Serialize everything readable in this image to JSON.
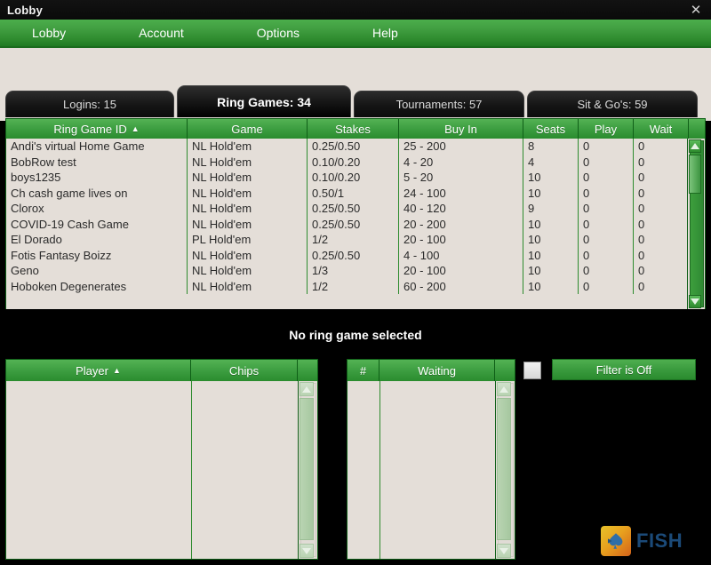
{
  "window": {
    "title": "Lobby",
    "close_label": "✕"
  },
  "menubar": {
    "items": [
      {
        "label": "Lobby"
      },
      {
        "label": "Account"
      },
      {
        "label": "Options"
      },
      {
        "label": "Help"
      }
    ]
  },
  "tabs": [
    {
      "label": "Logins: 15",
      "active": false
    },
    {
      "label": "Ring Games: 34",
      "active": true
    },
    {
      "label": "Tournaments: 57",
      "active": false
    },
    {
      "label": "Sit & Go's: 59",
      "active": false
    }
  ],
  "ring_table": {
    "columns": [
      {
        "label": "Ring Game ID",
        "sorted": true,
        "sort_indicator": "▲"
      },
      {
        "label": "Game",
        "sorted": false,
        "sort_indicator": ""
      },
      {
        "label": "Stakes",
        "sorted": false,
        "sort_indicator": ""
      },
      {
        "label": "Buy In",
        "sorted": false,
        "sort_indicator": ""
      },
      {
        "label": "Seats",
        "sorted": false,
        "sort_indicator": ""
      },
      {
        "label": "Play",
        "sorted": false,
        "sort_indicator": ""
      },
      {
        "label": "Wait",
        "sorted": false,
        "sort_indicator": ""
      }
    ],
    "rows": [
      {
        "id": "Andi's virtual Home Game",
        "game": "NL Hold'em",
        "stakes": "0.25/0.50",
        "buyin": "25 - 200",
        "seats": "8",
        "play": "0",
        "wait": "0"
      },
      {
        "id": "BobRow test",
        "game": "NL Hold'em",
        "stakes": "0.10/0.20",
        "buyin": "4 - 20",
        "seats": "4",
        "play": "0",
        "wait": "0"
      },
      {
        "id": "boys1235",
        "game": "NL Hold'em",
        "stakes": "0.10/0.20",
        "buyin": "5 - 20",
        "seats": "10",
        "play": "0",
        "wait": "0"
      },
      {
        "id": "Ch cash game lives on",
        "game": "NL Hold'em",
        "stakes": "0.50/1",
        "buyin": "24 - 100",
        "seats": "10",
        "play": "0",
        "wait": "0"
      },
      {
        "id": "Clorox",
        "game": "NL Hold'em",
        "stakes": "0.25/0.50",
        "buyin": "40 - 120",
        "seats": "9",
        "play": "0",
        "wait": "0"
      },
      {
        "id": "COVID-19 Cash Game",
        "game": "NL Hold'em",
        "stakes": "0.25/0.50",
        "buyin": "20 - 200",
        "seats": "10",
        "play": "0",
        "wait": "0"
      },
      {
        "id": "El Dorado",
        "game": "PL Hold'em",
        "stakes": "1/2",
        "buyin": "20 - 100",
        "seats": "10",
        "play": "0",
        "wait": "0"
      },
      {
        "id": "Fotis Fantasy Boizz",
        "game": "NL Hold'em",
        "stakes": "0.25/0.50",
        "buyin": "4 - 100",
        "seats": "10",
        "play": "0",
        "wait": "0"
      },
      {
        "id": "Geno",
        "game": "NL Hold'em",
        "stakes": "1/3",
        "buyin": "20 - 100",
        "seats": "10",
        "play": "0",
        "wait": "0"
      },
      {
        "id": "Hoboken Degenerates",
        "game": "NL Hold'em",
        "stakes": "1/2",
        "buyin": "60 - 200",
        "seats": "10",
        "play": "0",
        "wait": "0"
      }
    ],
    "scrollbar": {
      "up_icon": "triangle-up-icon",
      "down_icon": "triangle-down-icon"
    }
  },
  "status": {
    "message": "No ring game selected"
  },
  "player_panel": {
    "columns": [
      {
        "label": "Player",
        "sort_indicator": "▲"
      },
      {
        "label": "Chips",
        "sort_indicator": ""
      }
    ],
    "rows": []
  },
  "waiting_panel": {
    "columns": [
      {
        "label": "#",
        "sort_indicator": ""
      },
      {
        "label": "Waiting",
        "sort_indicator": ""
      }
    ],
    "rows": []
  },
  "filter": {
    "checkbox_checked": false,
    "button_label": "Filter is Off"
  },
  "branding": {
    "logo_text": "FISH",
    "logo_icon": "spade-icon"
  },
  "colors": {
    "green_accent": "#2e8b2e",
    "green_light": "#54b254",
    "panel_bg": "#e4ded8",
    "window_bg": "#000000",
    "logo_blue": "#1b4a78",
    "logo_orange": "#e8a11e"
  }
}
